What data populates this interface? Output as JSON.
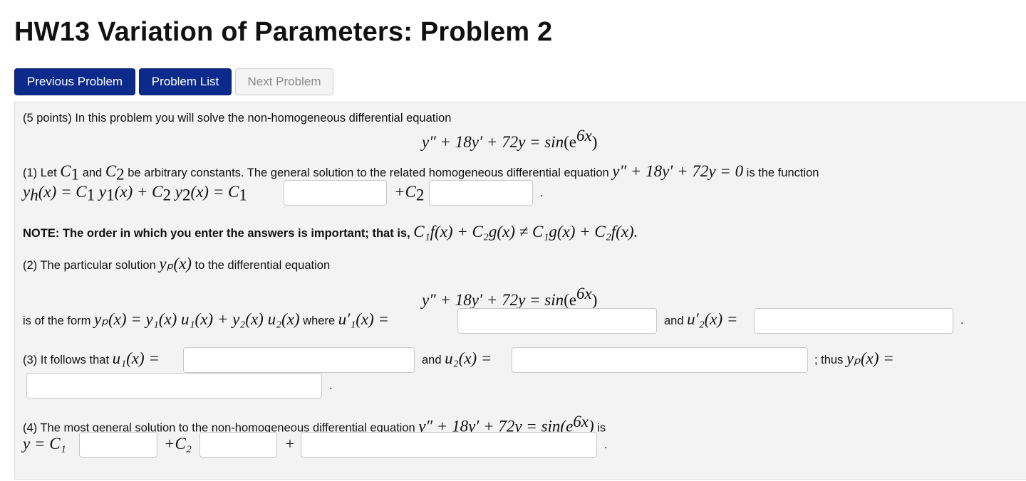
{
  "page": {
    "title": "HW13 Variation of Parameters: Problem 2"
  },
  "nav": {
    "prev_label": "Previous Problem",
    "list_label": "Problem List",
    "next_label": "Next Problem"
  },
  "problem": {
    "intro": "(5 points) In this problem you will solve the non-homogeneous differential equation",
    "ode_lhs": "y″ + 18y′ + 72y = sin",
    "ode_arg": "(e",
    "ode_exp": "6x",
    "ode_close": ")",
    "part1": {
      "text_a": "(1) Let ",
      "c1": "C",
      "text_and": " and ",
      "text_b": " be arbitrary constants. The general solution to the related homogeneous differential equation ",
      "hom_eq": "y″ + 18y′ + 72y = 0",
      "text_c": " is the function",
      "yh_expr": "y",
      "yh_rest": "(x) = C",
      "yh_mid": " y",
      "yh_mid2": "(x) + C",
      "yh_mid3": " y",
      "yh_end": "(x) = C",
      "plus_c2": "+C",
      "period": "."
    },
    "note": {
      "bold": "NOTE: The order in which you enter the answers is important; that is, ",
      "formula": "C₁f(x) + C₂g(x) ≠ C₁g(x) + C₂f(x).",
      "end": ""
    },
    "part2": {
      "text_a": "(2) The particular solution ",
      "yp": "yₚ(x)",
      "text_b": " to the differential equation",
      "form_text": "is of the form ",
      "form_eq": "yₚ(x) = y₁(x) u₁(x) + y₂(x) u₂(x)",
      "where": " where ",
      "u1p": "u′₁(x) =",
      "and": "and ",
      "u2p": "u′₂(x) =",
      "period": "."
    },
    "part3": {
      "text_a": "(3) It follows that ",
      "u1": "u₁(x) =",
      "and": "and ",
      "u2": "u₂(x) =",
      "thus": "; thus ",
      "yp": "yₚ(x) =",
      "period": "."
    },
    "part4": {
      "text_a": "(4) The most general solution to the non-homogeneous differential equation ",
      "eq": "y″ + 18y′ + 72y = sin(e",
      "exp": "6x",
      "eq_end": ")",
      "is": " is",
      "y_eq": "y = C₁",
      "plus_c2": "+C₂",
      "plus": "+",
      "period": "."
    }
  }
}
